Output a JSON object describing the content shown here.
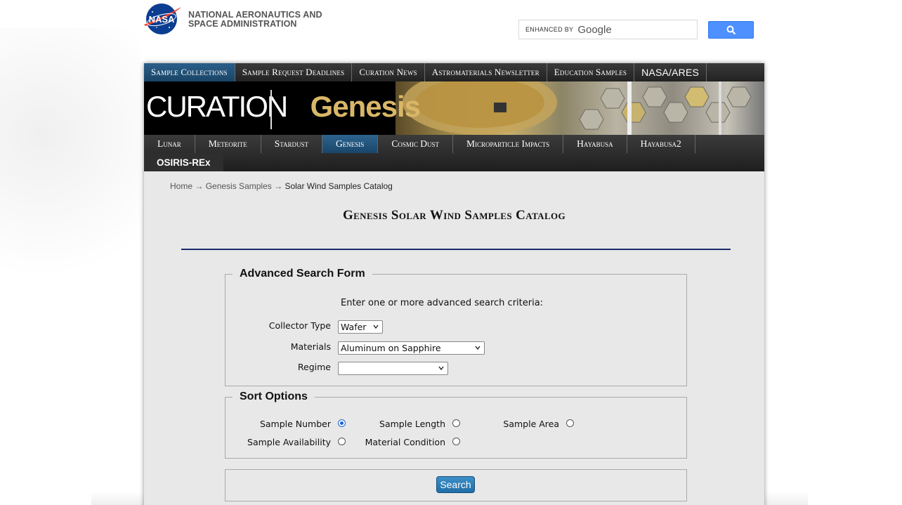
{
  "header": {
    "agency_line1": "NATIONAL AERONAUTICS AND",
    "agency_line2": "SPACE ADMINISTRATION",
    "logo_text": "NASA",
    "search": {
      "enhanced_by": "ENHANCED BY",
      "google": "Google",
      "button_icon": "magnifier-icon"
    }
  },
  "top_nav": [
    {
      "label": "Sample Collections",
      "active": true
    },
    {
      "label": "Sample Request Deadlines",
      "active": false
    },
    {
      "label": "Curation News",
      "active": false
    },
    {
      "label": "Astromaterials Newsletter",
      "active": false
    },
    {
      "label": "Education Samples",
      "active": false
    },
    {
      "label": "NASA/ARES",
      "active": false
    }
  ],
  "banner": {
    "curation": "CURATION",
    "section": "Genesis"
  },
  "sub_nav": [
    {
      "label": "Lunar",
      "active": false
    },
    {
      "label": "Meteorite",
      "active": false
    },
    {
      "label": "Stardust",
      "active": false
    },
    {
      "label": "Genesis",
      "active": true
    },
    {
      "label": "Cosmic Dust",
      "active": false
    },
    {
      "label": "Microparticle Impacts",
      "active": false
    },
    {
      "label": "Hayabusa",
      "active": false
    },
    {
      "label": "Hayabusa2",
      "active": false
    },
    {
      "label": "OSIRIS-REx",
      "active": false
    }
  ],
  "breadcrumb": {
    "home": "Home",
    "sep": "→",
    "parent": "Genesis Samples",
    "current": "Solar Wind Samples Catalog"
  },
  "page_title": "Genesis Solar Wind Samples Catalog",
  "search_form": {
    "legend": "Advanced Search Form",
    "instructions": "Enter one or more advanced search criteria:",
    "collector_type": {
      "label": "Collector Type",
      "value": "Wafer"
    },
    "materials": {
      "label": "Materials",
      "value": "Aluminum on Sapphire"
    },
    "regime": {
      "label": "Regime",
      "value": ""
    }
  },
  "sort_options": {
    "legend": "Sort Options",
    "options": [
      {
        "label": "Sample Number",
        "checked": true
      },
      {
        "label": "Sample Length",
        "checked": false
      },
      {
        "label": "Sample Area",
        "checked": false
      },
      {
        "label": "Sample Availability",
        "checked": false
      },
      {
        "label": "Material Condition",
        "checked": false
      }
    ]
  },
  "submit_label": "Search",
  "colors": {
    "nav_active": "#1f5480",
    "title_rule": "#1b2b6b",
    "genesis_gold": "#d9b768",
    "search_button": "#4d90fe"
  }
}
